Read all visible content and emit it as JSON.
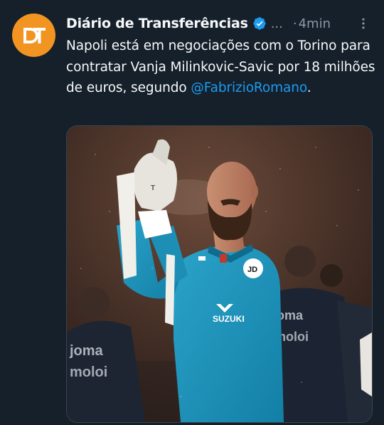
{
  "author": {
    "name": "Diário de Transferências",
    "handle": "...",
    "separator": "·",
    "time": "4min",
    "avatar_initials": "DT"
  },
  "tweet": {
    "text_before_mention": "Napoli está em negociações com o Torino para contratar Vanja Milinkovic-Savic por 18 milhões de euros, segundo ",
    "mention": "@FabrizioRomano",
    "text_after_mention": "."
  },
  "photo": {
    "jersey_sponsor": "SUZUKI",
    "badge_text": "JD",
    "bg_jacket_text": "joma",
    "bg_jacket_text2": "moloi"
  },
  "colors": {
    "background": "#15202b",
    "link": "#1d9bf0",
    "avatar": "#f29422",
    "verified": "#1d9bf0",
    "muted": "#8b98a5"
  },
  "icons": {
    "verified": "verified-badge-icon",
    "more": "more-dots-icon"
  }
}
